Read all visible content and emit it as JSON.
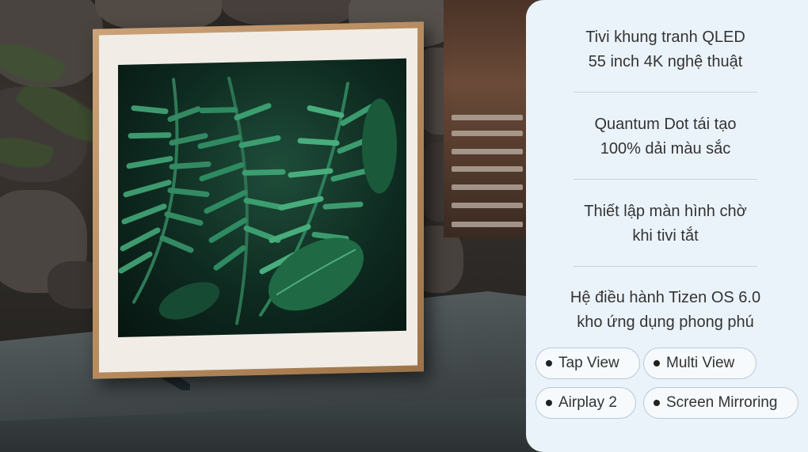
{
  "features": [
    {
      "line1": "Tivi khung tranh QLED",
      "line2": "55 inch 4K nghệ thuật"
    },
    {
      "line1": "Quantum Dot tái tạo",
      "line2": "100% dải màu sắc"
    },
    {
      "line1": "Thiết lập màn hình chờ",
      "line2": "khi tivi tắt"
    },
    {
      "line1": "Hệ điều hành Tizen OS 6.0",
      "line2": "kho ứng dụng phong phú"
    }
  ],
  "apps": [
    {
      "label": "Tap View",
      "icon": "bullet-icon"
    },
    {
      "label": "Multi View",
      "icon": "bullet-icon"
    },
    {
      "label": "Airplay 2",
      "icon": "bullet-icon"
    },
    {
      "label": "Screen Mirroring",
      "icon": "bullet-icon"
    }
  ],
  "colors": {
    "panel_background": "#ebf3fa",
    "frame_wood": "#b68b5e",
    "text": "#333333",
    "pill_border": "#b8c8d6"
  }
}
